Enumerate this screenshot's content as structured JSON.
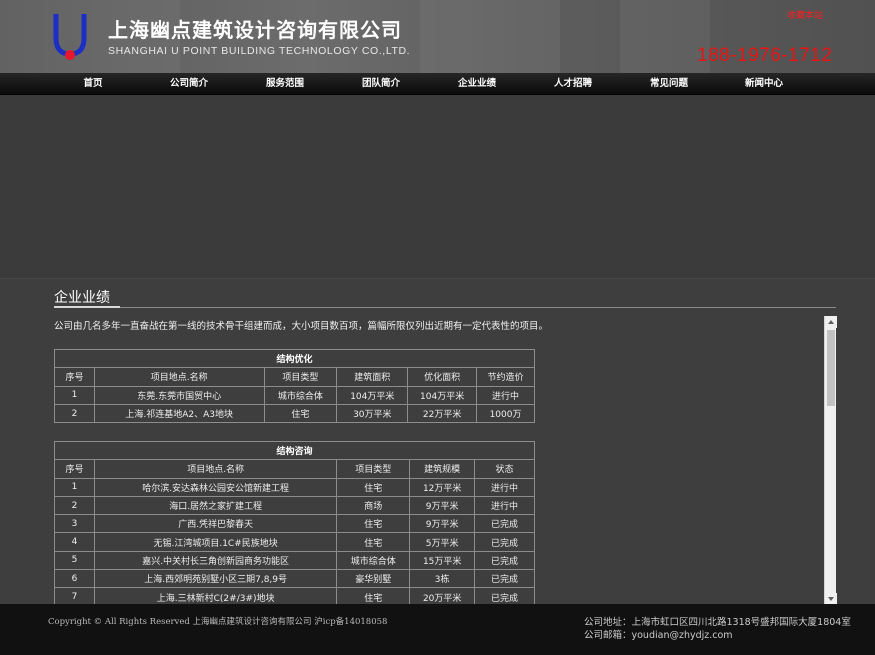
{
  "header": {
    "company_cn": "上海幽点建筑设计咨询有限公司",
    "company_en": "SHANGHAI U POINT BUILDING TECHNOLOGY CO.,LTD.",
    "bookmark_label": "收藏本站",
    "hotline": "188-1976-1712",
    "brand_colors": {
      "logo_blue": "#1c2fc4",
      "logo_red": "#e8182c",
      "hotline_red": "#e81414"
    }
  },
  "nav": {
    "items": [
      {
        "label": "首页"
      },
      {
        "label": "公司简介"
      },
      {
        "label": "服务范围"
      },
      {
        "label": "团队简介"
      },
      {
        "label": "企业业绩"
      },
      {
        "label": "人才招聘"
      },
      {
        "label": "常见问题"
      },
      {
        "label": "新闻中心"
      }
    ]
  },
  "main": {
    "section_title": "企业业绩",
    "intro": "公司由几名多年一直奋战在第一线的技术骨干组建而成，大小项目数百项，篇幅所限仅列出近期有一定代表性的项目。",
    "table1": {
      "caption": "结构优化",
      "headers": [
        "序号",
        "项目地点.名称",
        "项目类型",
        "建筑面积",
        "优化面积",
        "节约造价"
      ],
      "rows": [
        [
          "1",
          "东莞.东莞市国贸中心",
          "城市综合体",
          "104万平米",
          "104万平米",
          "进行中"
        ],
        [
          "2",
          "上海.祁连基地A2、A3地块",
          "住宅",
          "30万平米",
          "22万平米",
          "1000万"
        ]
      ]
    },
    "table2": {
      "caption": "结构咨询",
      "headers": [
        "序号",
        "项目地点.名称",
        "项目类型",
        "建筑规模",
        "状态"
      ],
      "rows": [
        [
          "1",
          "哈尔滨.安达森林公园安公馆新建工程",
          "住宅",
          "12万平米",
          "进行中"
        ],
        [
          "2",
          "海口.居然之家扩建工程",
          "商场",
          "9万平米",
          "进行中"
        ],
        [
          "3",
          "广西.凭祥巴黎春天",
          "住宅",
          "9万平米",
          "已完成"
        ],
        [
          "4",
          "无锡.江湾城项目.1C#民族地块",
          "住宅",
          "5万平米",
          "已完成"
        ],
        [
          "5",
          "嘉兴.中关村长三角创新园商务功能区",
          "城市综合体",
          "15万平米",
          "已完成"
        ],
        [
          "6",
          "上海.西郊明苑别墅小区三期7,8,9号",
          "豪华别墅",
          "3栋",
          "已完成"
        ],
        [
          "7",
          "上海.三林新村C(2#/3#)地块",
          "住宅",
          "20万平米",
          "已完成"
        ]
      ]
    }
  },
  "footer": {
    "copyright": "Copyright © All Rights Reserved 上海幽点建筑设计咨询有限公司 沪icp备14018058",
    "address": "公司地址：上海市虹口区四川北路1318号盛邦国际大厦1804室",
    "email": "公司邮箱：youdian@zhydjz.com"
  }
}
